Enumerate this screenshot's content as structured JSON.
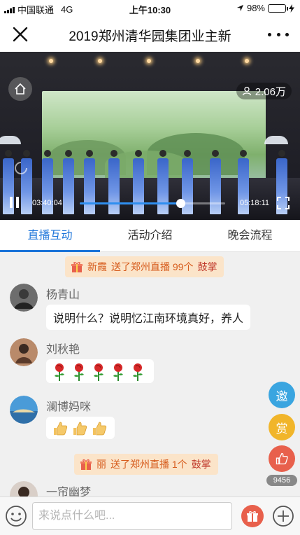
{
  "status_bar": {
    "carrier": "中国联通",
    "network": "4G",
    "time": "上午10:30",
    "battery": "98%"
  },
  "nav": {
    "title": "2019郑州清华园集团业主新"
  },
  "video": {
    "viewers": "2.06万",
    "current_time": "03:40:04",
    "total_time": "05:18:11",
    "progress_fraction": 0.69
  },
  "tabs": [
    {
      "label": "直播互动",
      "active": true
    },
    {
      "label": "活动介绍",
      "active": false
    },
    {
      "label": "晚会流程",
      "active": false
    }
  ],
  "chat": {
    "gift_notices": [
      {
        "user": "新霞",
        "text": "送了郑州直播 99个",
        "item": "鼓掌"
      },
      {
        "user": "丽",
        "text": "送了郑州直播 1个",
        "item": "鼓掌"
      }
    ],
    "messages": [
      {
        "user": "杨青山",
        "text": "说明什么？说明忆江南环境真好，养人"
      },
      {
        "user": "刘秋艳",
        "emoji": "rose",
        "count": 5
      },
      {
        "user": "澜博妈咪",
        "emoji": "thumbs-up",
        "count": 3
      },
      {
        "user": "一帘幽梦"
      }
    ]
  },
  "side_buttons": {
    "invite": "邀",
    "reward": "赏",
    "like_count": "9456"
  },
  "input": {
    "placeholder": "来说点什么吧..."
  },
  "colors": {
    "accent": "#1a73d9",
    "gift_bg": "#fbe4c9",
    "gift_text": "#d65a1a",
    "invite": "#3aa5e0",
    "reward": "#f1b52a",
    "like": "#e8604c"
  }
}
